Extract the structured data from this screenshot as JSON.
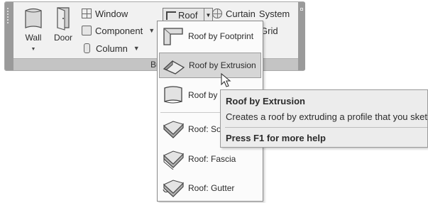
{
  "ribbon": {
    "panel_label": "Bui",
    "wall": {
      "label": "Wall",
      "icon": "wall-icon"
    },
    "door": {
      "label": "Door",
      "icon": "door-icon"
    },
    "window": {
      "label": "Window",
      "icon": "window-icon"
    },
    "component": {
      "label": "Component",
      "icon": "component-icon"
    },
    "column": {
      "label": "Column",
      "icon": "column-icon"
    },
    "roof": {
      "label": "Roof",
      "icon": "roof-icon"
    },
    "curtain_system": {
      "label": "Curtain",
      "label2": "System",
      "icon": "curtain-system-icon"
    },
    "grid_label": "Grid"
  },
  "menu": {
    "items": [
      {
        "label": "Roof by Footprint",
        "icon": "roof-footprint-icon"
      },
      {
        "label": "Roof by Extrusion",
        "icon": "roof-extrusion-icon",
        "highlighted": true
      },
      {
        "label": "Roof by F",
        "icon": "roof-face-icon"
      },
      {
        "label": "Roof: Sof",
        "icon": "roof-soffit-icon"
      },
      {
        "label": "Roof: Fascia",
        "icon": "roof-fascia-icon"
      },
      {
        "label": "Roof: Gutter",
        "icon": "roof-gutter-icon"
      }
    ]
  },
  "tooltip": {
    "title": "Roof by Extrusion",
    "description": "Creates a roof by extruding a profile that you sketch.",
    "help": "Press F1 for more help"
  },
  "colors": {
    "ribbon_bg": "#f1f1f1",
    "highlight": "#d6d6d6",
    "tooltip_bg": "#ececec"
  }
}
